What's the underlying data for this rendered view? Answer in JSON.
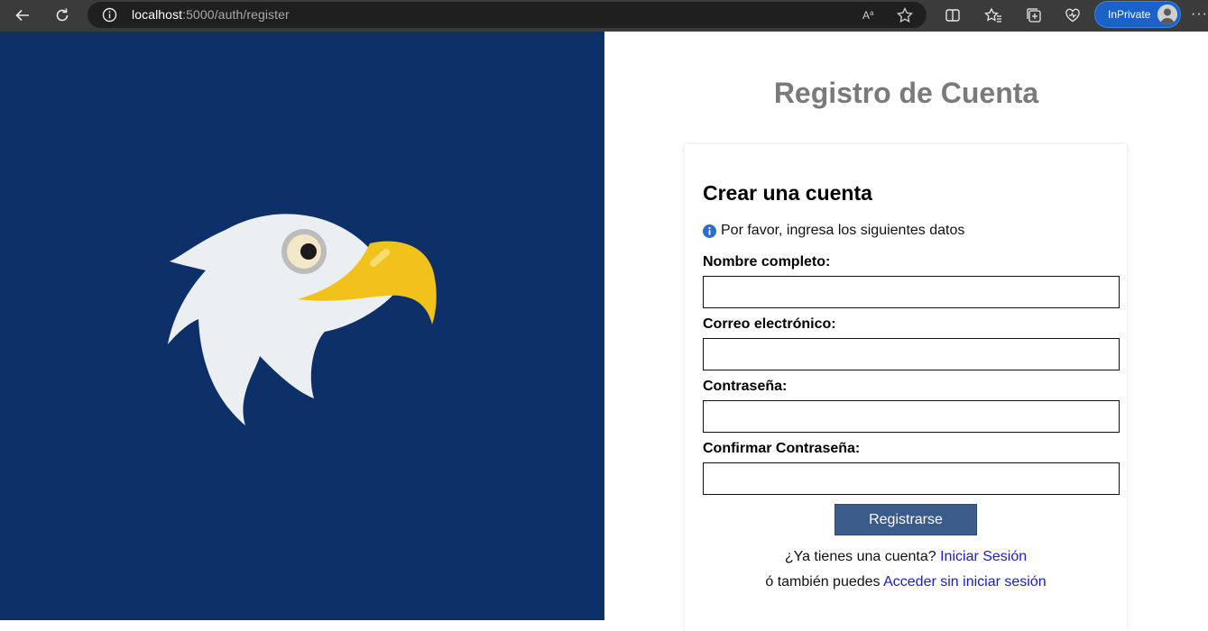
{
  "browser": {
    "url_host": "localhost",
    "url_path": ":5000/auth/register",
    "inprivate_label": "InPrivate"
  },
  "page": {
    "title": "Registro de Cuenta"
  },
  "form": {
    "heading": "Crear una cuenta",
    "note": "Por favor, ingresa los siguientes datos",
    "fields": [
      {
        "label": "Nombre completo:",
        "value": "",
        "placeholder": ""
      },
      {
        "label": "Correo electrónico:",
        "value": "",
        "placeholder": ""
      },
      {
        "label": "Contraseña:",
        "value": "",
        "placeholder": ""
      },
      {
        "label": "Confirmar Contraseña:",
        "value": "",
        "placeholder": ""
      }
    ],
    "submit_label": "Registrarse",
    "login_prompt": "¿Ya tienes una cuenta?",
    "login_link": "Iniciar Sesión",
    "guest_prompt": "ó también puedes",
    "guest_link": "Acceder sin iniciar sesión"
  },
  "colors": {
    "left_panel": "#0d3068",
    "title_gray": "#7a7a7a",
    "button": "#3b5b8a",
    "link": "#1a1acd",
    "eagle_head": "#eceff1",
    "eagle_beak": "#f1c21b"
  },
  "icons": [
    "back-arrow-icon",
    "refresh-icon",
    "info-icon",
    "read-aloud-icon",
    "favorite-star-icon",
    "split-screen-icon",
    "favorites-icon",
    "collections-icon",
    "browser-essentials-icon",
    "more-icon",
    "eagle-logo"
  ]
}
